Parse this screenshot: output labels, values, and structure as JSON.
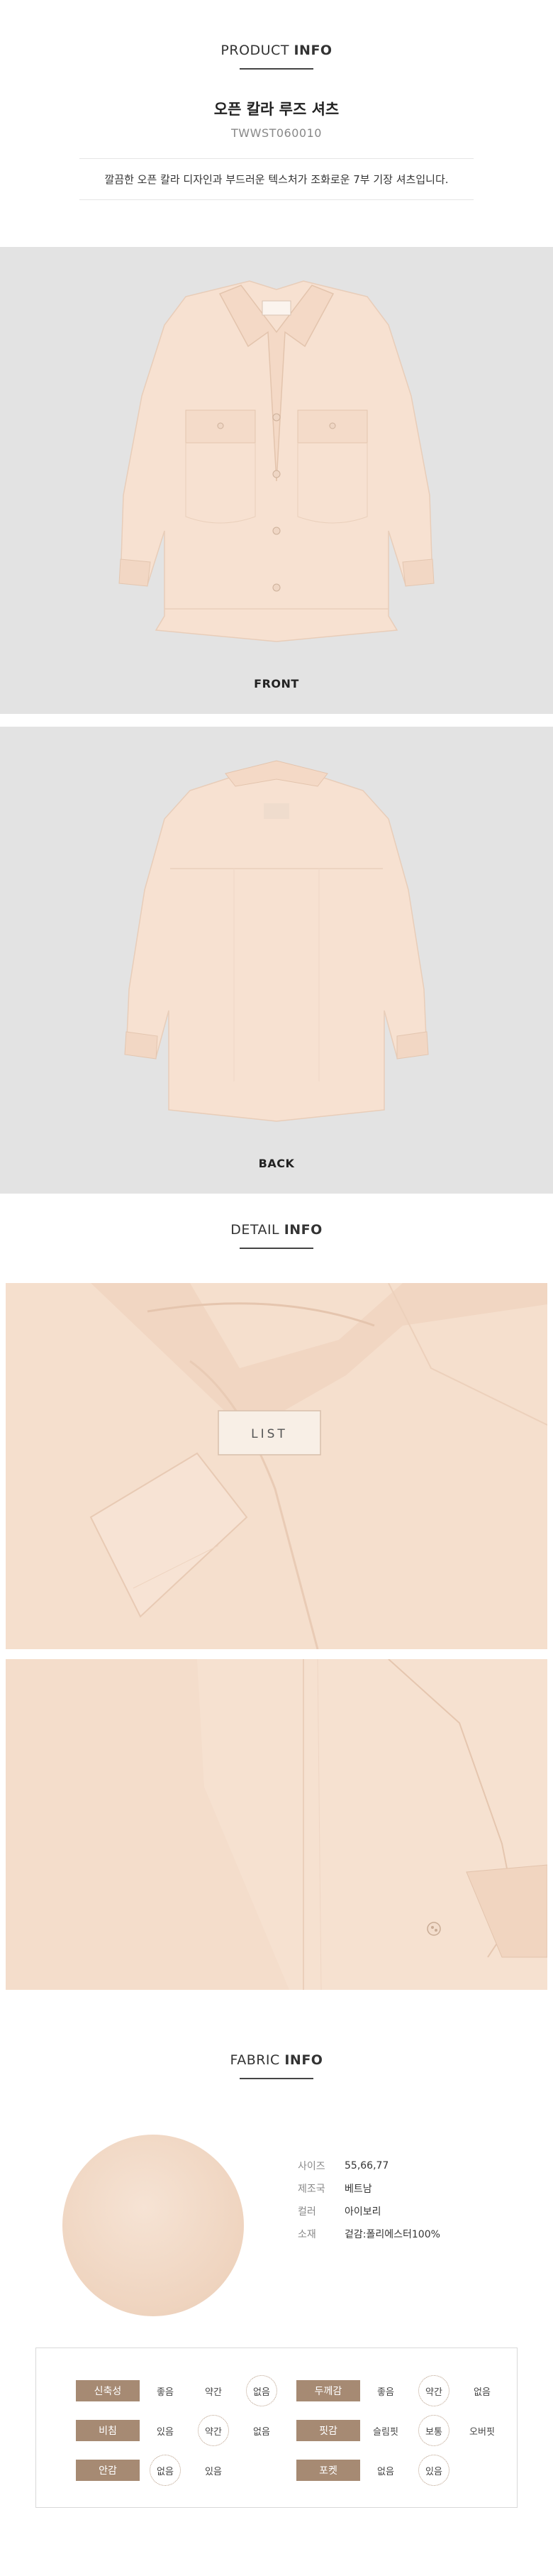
{
  "product_info": {
    "title_light": "PRODUCT",
    "title_bold": "INFO",
    "product_name": "오픈 칼라 루즈 셔츠",
    "product_code": "TWWST060010",
    "description": "깔끔한 오픈 칼라 디자인과 부드러운 텍스처가 조화로운 7부 기장 셔츠입니다."
  },
  "photos": {
    "front_caption": "FRONT",
    "back_caption": "BACK",
    "label_text": "LIST"
  },
  "detail_info": {
    "title_light": "DETAIL",
    "title_bold": "INFO",
    "label_text": "LIST"
  },
  "fabric_info": {
    "title_light": "FABRIC",
    "title_bold": "INFO",
    "specs": [
      {
        "key": "사이즈",
        "value": "55,66,77"
      },
      {
        "key": "제조국",
        "value": "베트남"
      },
      {
        "key": "컬러",
        "value": "아이보리"
      },
      {
        "key": "소재",
        "value": "겉감:폴리에스터100%"
      }
    ]
  },
  "attributes": [
    [
      {
        "label": "신축성",
        "options": [
          "좋음",
          "약간",
          "없음"
        ],
        "selected": 2
      },
      {
        "label": "두께감",
        "options": [
          "좋음",
          "약간",
          "없음"
        ],
        "selected": 1
      }
    ],
    [
      {
        "label": "비침",
        "options": [
          "있음",
          "약간",
          "없음"
        ],
        "selected": 1
      },
      {
        "label": "핏감",
        "options": [
          "슬림핏",
          "보통",
          "오버핏"
        ],
        "selected": 1
      }
    ],
    [
      {
        "label": "안감",
        "options": [
          "없음",
          "있음"
        ],
        "selected": 0
      },
      {
        "label": "포켓",
        "options": [
          "없음",
          "있음"
        ],
        "selected": 1
      }
    ]
  ],
  "colors": {
    "photo_bg": "#e3e3e3",
    "garment": "#f7e1d1",
    "label_bg": "#a68a73"
  }
}
